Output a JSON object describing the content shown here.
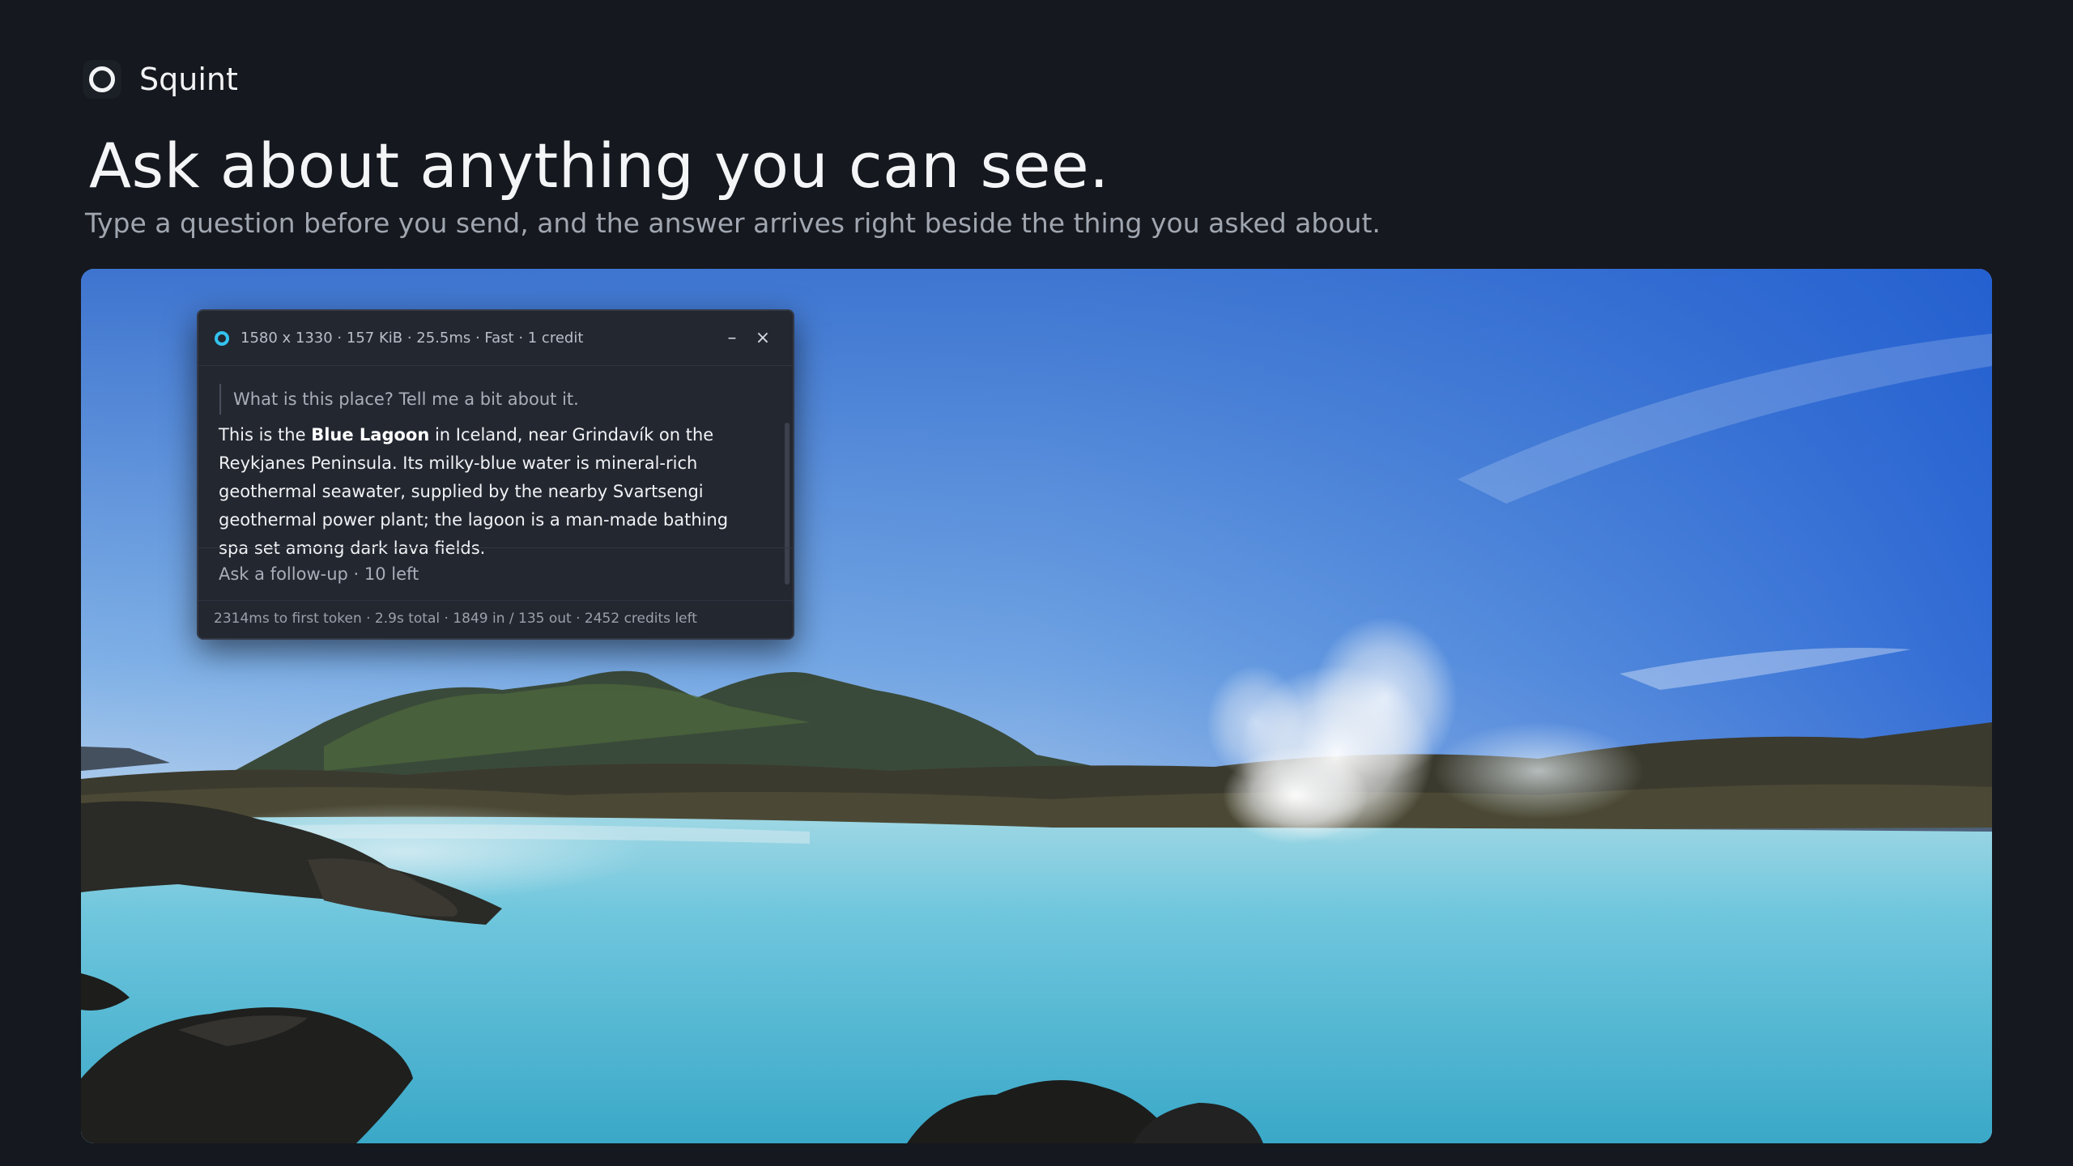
{
  "app": {
    "name": "Squint",
    "icon": "ring-logo-icon"
  },
  "hero": {
    "headline": "Ask about anything you can see.",
    "subline": "Type a question before you send, and the answer arrives right beside the thing you asked about."
  },
  "panel": {
    "status_color": "#33c3ef",
    "meta": "1580 x 1330 · 157 KiB · 25.5ms · Fast · 1 credit",
    "minimize_label": "–",
    "close_label": "×",
    "question": "What is this place? Tell me a bit about it.",
    "answer": {
      "before": "This is the ",
      "bold": "Blue Lagoon",
      "after": " in Iceland, near Grindavík on the Reykjanes Peninsula. Its milky-blue water is mineral-rich geothermal seawater, supplied by the nearby Svartsengi geothermal power plant; the lagoon is a man-made bathing spa set among dark lava fields."
    },
    "follow_up_placeholder": "Ask a follow-up · 10 left",
    "stats": "2314ms to first token · 2.9s total · 1849 in / 135 out · 2452 credits left"
  },
  "colors": {
    "background": "#15181e",
    "panel": "#232730",
    "accent": "#33c3ef"
  }
}
